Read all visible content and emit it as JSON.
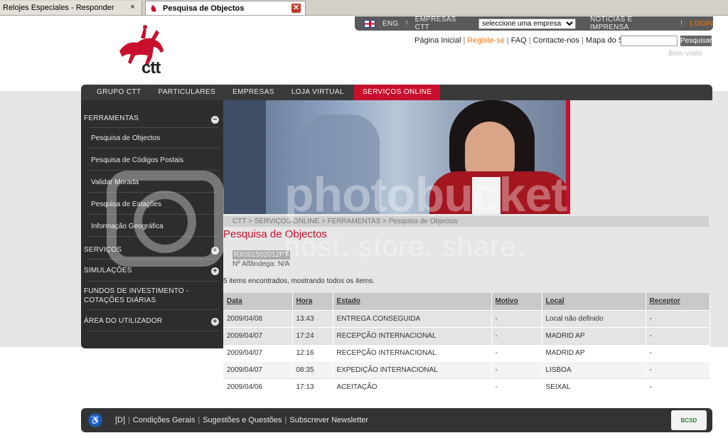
{
  "browser": {
    "tabs": [
      {
        "label": "Relojes Especiales - Responder",
        "close": "×"
      },
      {
        "label": "Pesquisa de Objectos",
        "close": "✕"
      }
    ]
  },
  "utility": {
    "lang": "ENG",
    "companies_label": "EMPRESAS CTT",
    "company_select": "seleccione uma empresa",
    "news": "NOTÍCIAS E IMPRENSA",
    "login": "LOGIN",
    "sep": "!"
  },
  "logo": {
    "text": "ctt"
  },
  "toplinks": {
    "home": "Página Inicial",
    "register": "Registe-se",
    "faq": "FAQ",
    "contact": "Contacte-nos",
    "sitemap": "Mapa do Site",
    "search_button": "Pesquisar",
    "welcome": "Bem-vindo"
  },
  "mainnav": {
    "items": [
      "GRUPO CTT",
      "PARTICULARES",
      "EMPRESAS",
      "LOJA VIRTUAL",
      "SERVIÇOS ONLINE"
    ],
    "active": "SERVIÇOS ONLINE"
  },
  "sidebar": {
    "tools": "FERRAMENTAS",
    "tools_items": [
      "Pesquisa de Objectos",
      "Pesquisa de Códigos Postais",
      "Validar Morada",
      "Pesquisa de Estações",
      "Informação Geográfica"
    ],
    "services": "SERVIÇOS",
    "simulations": "SIMULAÇÕES",
    "funds": "FUNDOS DE INVESTIMENTO - COTAÇÕES DIÁRIAS",
    "user_area": "ÁREA DO UTILIZADOR",
    "collapse_symbol": "−",
    "expand_symbol": "+"
  },
  "breadcrumb": "CTT > SERVIÇOS ONLINE > FERRAMENTAS > Pesquisa de Objectos",
  "page_title": "Pesquisa de Objectos",
  "object_code": "RX001502012PT",
  "customs": "Nº Alfândega: N/A",
  "found_text": "5 items encontrados, mostrando todos os items.",
  "table": {
    "headers": [
      "Data",
      "Hora",
      "Estado",
      "Motivo",
      "Local",
      "Receptor"
    ],
    "rows": [
      [
        "2009/04/08",
        "13:43",
        "ENTREGA CONSEGUIDA",
        "-",
        "Local não definido",
        "-"
      ],
      [
        "2009/04/07",
        "17:24",
        "RECEPÇÃO INTERNACIONAL",
        "-",
        "MADRID AP",
        "-"
      ],
      [
        "2009/04/07",
        "12:16",
        "RECEPÇÃO INTERNACIONAL",
        "-",
        "MADRID AP",
        "-"
      ],
      [
        "2009/04/07",
        "08:35",
        "EXPEDIÇÃO INTERNACIONAL",
        "-",
        "LISBOA",
        "-"
      ],
      [
        "2009/04/06",
        "17:13",
        "ACEITAÇÃO",
        "-",
        "SEIXAL",
        "-"
      ]
    ]
  },
  "footer": {
    "access_key": "[D]",
    "terms": "Condições Gerais",
    "suggestions": "Sugestões e Questões",
    "newsletter": "Subscrever Newsletter",
    "badge": "BCSD"
  },
  "watermark": {
    "line1": "photobucket",
    "line2": "host. store. share."
  }
}
